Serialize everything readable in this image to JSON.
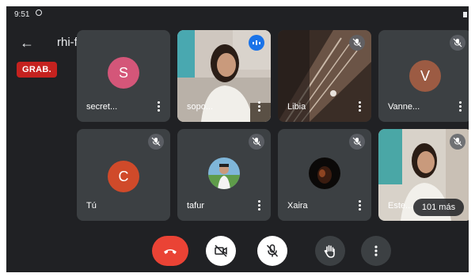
{
  "status_bar": {
    "time": "9:51"
  },
  "header": {
    "meeting_code": "rhi-frnq-mfp"
  },
  "recording_badge": "GRAB.",
  "tiles": [
    {
      "name": "secret...",
      "initial": "S",
      "avatar_color": "#d45679",
      "muted": false
    },
    {
      "name": "sopo...",
      "video": true,
      "speaking": true
    },
    {
      "name": "Libia",
      "video": true,
      "muted": true
    },
    {
      "name": "Vanne...",
      "initial": "V",
      "avatar_color": "#9c5b43",
      "muted": true
    },
    {
      "name": "Tú",
      "initial": "C",
      "avatar_color": "#d04a2a",
      "muted": true
    },
    {
      "name": "tafur",
      "photo_avatar": true,
      "muted": true
    },
    {
      "name": "Xaira",
      "photo_avatar": true,
      "muted": true
    },
    {
      "name": "Este...",
      "video": true,
      "muted": true,
      "overflow_label": "101 más"
    }
  ],
  "controls": [
    {
      "name": "end-call",
      "icon": "call-end-icon",
      "color": "#ea4335"
    },
    {
      "name": "camera-toggle",
      "icon": "camera-off-icon",
      "state": "off"
    },
    {
      "name": "mic-toggle",
      "icon": "mic-off-icon",
      "state": "off"
    },
    {
      "name": "raise-hand",
      "icon": "hand-icon"
    },
    {
      "name": "more-options",
      "icon": "more-vert-icon"
    }
  ]
}
